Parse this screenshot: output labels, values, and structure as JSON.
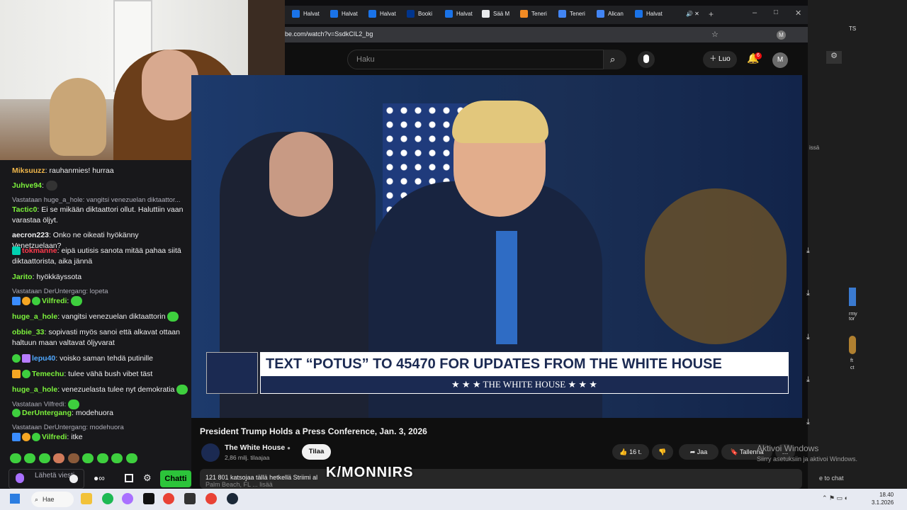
{
  "browser": {
    "tabs": [
      "Halvat",
      "Halvat",
      "Halvat",
      "Booki",
      "Halvat",
      "Sää M",
      "Teneri",
      "Teneri",
      "Alican",
      "Halvat"
    ],
    "tab_colors": [
      "#1a73e8",
      "#1a73e8",
      "#1a73e8",
      "#00358e",
      "#1a73e8",
      "#e8eaed",
      "#f28b24",
      "#4285f4",
      "#4285f4",
      "#1a73e8"
    ],
    "url": "be.com/watch?v=SsdkCIL2_bg"
  },
  "youtube": {
    "search_placeholder": "Haku",
    "create_label": "Luo",
    "notifications": "6",
    "avatar": "M"
  },
  "video": {
    "lower_third": "TEXT “POTUS” TO 45470 FOR UPDATES FROM THE WHITE HOUSE",
    "lower_third_sub": "★ ★ ★   THE WHITE HOUSE   ★ ★ ★",
    "title": "President Trump Holds a Press Conference, Jan. 3, 2026",
    "channel": "The White House",
    "subscribers": "2,86 milj. tilaajaa",
    "subscribe_label": "Tilaa",
    "likes": "16 t.",
    "share_label": "Jaa",
    "save_label": "Tallenna",
    "description": "121 801 katsojaa tällä hetkellä  Striimi al",
    "description_line2": "Palm Beach, FL ... lisää",
    "overlay_text": "K/MONNIRS"
  },
  "chat": {
    "messages": [
      {
        "user": "Miksuuzz",
        "color": "#f2b84b",
        "text": "rauhanmies! hurraa"
      },
      {
        "user": "Juhve94",
        "color": "#7cf23c",
        "text": ""
      },
      {
        "reply": "Vastataan huge_a_hole: vangitsi venezuelan diktaattor..."
      },
      {
        "user": "Tactic0",
        "color": "#7cf23c",
        "text": "Ei se mikään diktaattori ollut. Haluttiin vaan varastaa öljyt."
      },
      {
        "user": "aecron223",
        "color": "#efeff1",
        "text": "Onko ne oikeati hyökänny Venetzuelaan?"
      },
      {
        "user": "tokmanne",
        "color": "#ff3a4c",
        "text": "eipä uutisis sanota mitää pahaa siitä diktaattorista, aika jännä"
      },
      {
        "user": "Jarito",
        "color": "#7cf23c",
        "text": "hyökkäyssota"
      },
      {
        "reply": "Vastataan DerUntergang: lopeta"
      },
      {
        "user": "Vilfredi",
        "color": "#7cf23c",
        "text": ""
      },
      {
        "user": "huge_a_hole",
        "color": "#7cf23c",
        "text": "vangitsi venezuelan diktaattorin"
      },
      {
        "user": "obbie_33",
        "color": "#7cf23c",
        "text": "sopivasti myös sanoi että alkavat ottaan haltuun maan valtavat öljyvarat"
      },
      {
        "user": "lepu40",
        "color": "#4fa8ff",
        "text": "voisko saman tehdä putinille"
      },
      {
        "user": "Temechu",
        "color": "#7cf23c",
        "text": "tulee vähä bush vibet täst"
      },
      {
        "user": "huge_a_hole",
        "color": "#7cf23c",
        "text": "venezuelasta tulee nyt demokratia"
      },
      {
        "reply": "Vastataan Vilfredi:"
      },
      {
        "user": "DerUntergang",
        "color": "#7cf23c",
        "text": "modehuora"
      },
      {
        "reply": "Vastataan DerUntergang: modehuora"
      },
      {
        "user": "Vilfredi",
        "color": "#7cf23c",
        "text": "itke"
      }
    ],
    "input_placeholder": "Lähetä viesti",
    "send_label": "Chatti"
  },
  "windows": {
    "activation_title": "Aktivoi Windows",
    "activation_sub": "Siirry asetuksiin ja aktivoi Windows.",
    "taskbar_search": "Hae",
    "time": "18.40",
    "date": "3.1.2026"
  },
  "right_panel": {
    "snippet1": "TS",
    "snippet2": "issä",
    "snippet3": "rmy tor",
    "snippet4": "ft",
    "snippet5": "ct",
    "share_to_chat": "e to chat"
  }
}
